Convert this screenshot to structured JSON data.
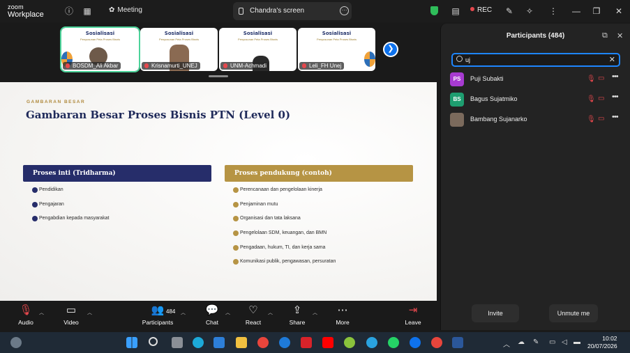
{
  "app": {
    "brand_line1": "zoom",
    "brand_line2": "Workplace"
  },
  "topbar": {
    "meeting_label": "Meeting",
    "screen_share_label": "Chandra's screen",
    "rec_label": "REC",
    "icons": [
      "info-icon",
      "grid-icon",
      "meeting-icon",
      "shield-icon",
      "notes-icon",
      "record-icon",
      "draw-icon",
      "sparkle-icon",
      "minimize-icon",
      "restore-icon",
      "close-icon"
    ]
  },
  "thumbnails": [
    {
      "title": "Sosialisasi",
      "subtitle": "Penyusunan Peta Proses Bisnis",
      "name": "BOSDM_Ali Akbar"
    },
    {
      "title": "Sosialisasi",
      "subtitle": "Penyusunan Peta Proses Bisnis",
      "name": "Krisnamurti_UNEJ"
    },
    {
      "title": "Sosialisasi",
      "subtitle": "Penyusunan Peta Proses Bisnis",
      "name": "UNM-Achmadi"
    },
    {
      "title": "Sosialisasi",
      "subtitle": "Penyusunan Peta Proses Bisnis",
      "name": "Leli_FH Unej"
    }
  ],
  "slide": {
    "eyebrow": "GAMBARAN BESAR",
    "heading": "Gambaran Besar Proses Bisnis PTN (Level 0)",
    "left_header": "Proses inti (Tridharma)",
    "left_items": [
      "Pendidikan",
      "Pengajaran",
      "Pengabdian kepada masyarakat"
    ],
    "right_header": "Proses pendukung (contoh)",
    "right_items": [
      "Perencanaan dan pengelolaan kinerja",
      "Penjaminan mutu",
      "Organisasi dan tata laksana",
      "Pengelolaan SDM, keuangan, dan BMN",
      "Pengadaan, hukum, TI, dan kerja sama",
      "Komunikasi publik, pengawasan, persuratan"
    ]
  },
  "toolbar": {
    "audio": "Audio",
    "video": "Video",
    "participants": "Participants",
    "participants_count": "484",
    "chat": "Chat",
    "react": "React",
    "share": "Share",
    "more": "More",
    "leave": "Leave"
  },
  "panel": {
    "title": "Participants (484)",
    "search_value": "uj",
    "participants": [
      {
        "initials": "PS",
        "name": "Puji Subakti",
        "avatar_color": "#a73bd1"
      },
      {
        "initials": "BS",
        "name": "Bagus Sujatmiko",
        "avatar_color": "#1e9e70"
      },
      {
        "initials": "",
        "name": "Bambang Sujanarko",
        "avatar_color": "#7b6a5c"
      }
    ],
    "invite_label": "Invite",
    "unmute_label": "Unmute me"
  },
  "taskbar": {
    "time": "10:02",
    "date": "20/07/2026"
  },
  "colors": {
    "accent": "#0e72ed",
    "navy": "#262d6a",
    "gold": "#b69444",
    "danger": "#e5484d"
  }
}
